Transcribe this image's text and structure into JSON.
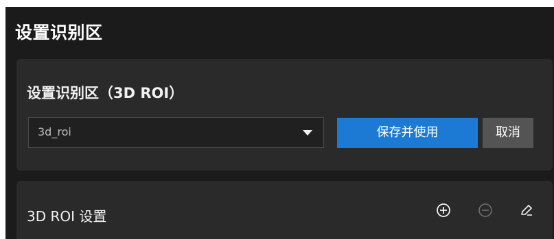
{
  "page": {
    "title": "设置识别区"
  },
  "roi_card": {
    "title": "设置识别区（3D ROI）",
    "select": {
      "value": "3d_roi"
    },
    "save_button": "保存并使用",
    "cancel_button": "取消"
  },
  "settings_card": {
    "title": "3D ROI 设置",
    "icons": [
      "plus-circle-icon",
      "minus-circle-icon",
      "pencil-edit-icon"
    ]
  },
  "colors": {
    "background": "#1b1b1b",
    "card": "#2a2a2a",
    "primary": "#1c7ad4",
    "secondary_button": "#545454",
    "text": "#f2f2f2",
    "muted_text": "#bdbdbd"
  }
}
